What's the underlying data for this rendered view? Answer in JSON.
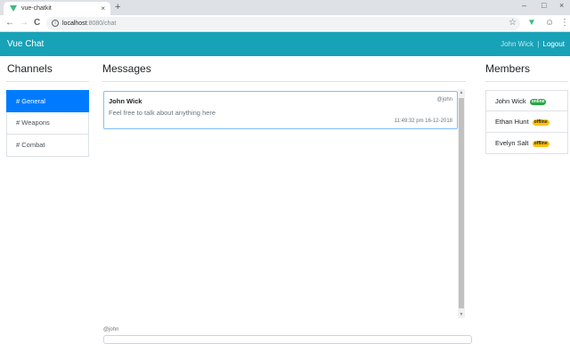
{
  "browser": {
    "tab_title": "vue-chatkit",
    "tab_close": "×",
    "new_tab": "+",
    "url_host": "localhost",
    "url_path": ":8080/chat",
    "back": "←",
    "forward": "→",
    "reload": "C",
    "star": "☆",
    "ext_icon": "▼",
    "account": "☺",
    "menu": "⋮",
    "minimize": "–",
    "maximize": "□",
    "close": "×"
  },
  "navbar": {
    "brand": "Vue Chat",
    "user": "John Wick",
    "separator": "|",
    "logout": "Logout",
    "color": "#17a2b8"
  },
  "channels": {
    "title": "Channels",
    "items": [
      {
        "label": "# General",
        "active": true
      },
      {
        "label": "# Weapons",
        "active": false
      },
      {
        "label": "# Combat",
        "active": false
      }
    ]
  },
  "messages": {
    "title": "Messages",
    "items": [
      {
        "author": "John Wick",
        "handle": "@john",
        "text": "Feel free to talk about anything here",
        "time": "11:49:32 pm 16-12-2018"
      }
    ],
    "scroll_up": "▲",
    "scroll_down": "▼"
  },
  "members": {
    "title": "Members",
    "items": [
      {
        "name": "John Wick",
        "status": "online"
      },
      {
        "name": "Ethan Hunt",
        "status": "offline"
      },
      {
        "name": "Evelyn Salt",
        "status": "offline"
      }
    ]
  },
  "composer": {
    "label": "@john",
    "value": ""
  }
}
